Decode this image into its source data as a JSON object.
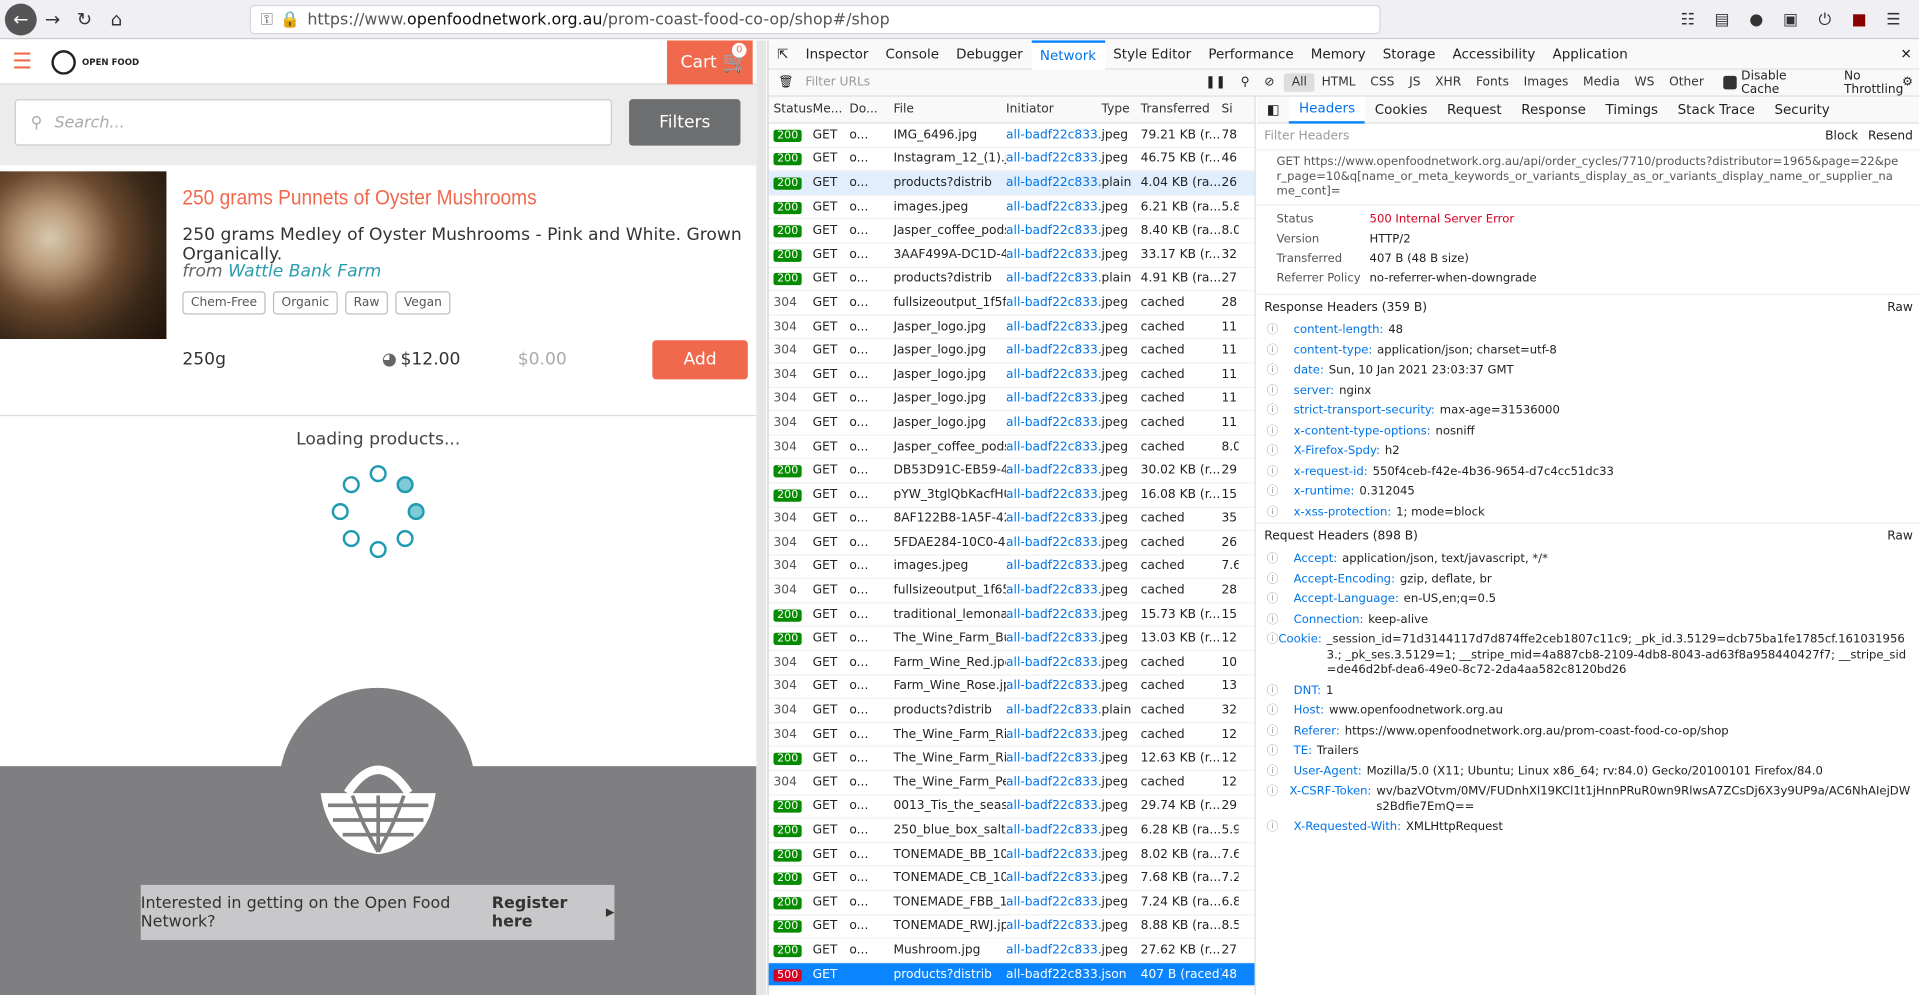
{
  "browser": {
    "url_prefix": "https://www.",
    "url_domain": "openfoodnetwork.org.au",
    "url_path": "/prom-coast-food-co-op/shop#/shop"
  },
  "shop": {
    "logo_text": "OPEN FOOD",
    "cart_label": "Cart",
    "cart_count": "0",
    "search_placeholder": "Search...",
    "filters_label": "Filters",
    "product": {
      "title": "250 grams Punnets of Oyster Mushrooms",
      "description": "250 grams Medley of Oyster Mushrooms - Pink and White. Grown Organically.",
      "from_prefix": "from",
      "producer": "Wattle Bank Farm",
      "tags": [
        "Chem-Free",
        "Organic",
        "Raw",
        "Vegan"
      ],
      "unit": "250g",
      "price": "$12.00",
      "price_zero": "$0.00",
      "add_label": "Add"
    },
    "loading": "Loading products...",
    "register_text": "Interested in getting on the Open Food Network?",
    "register_link": "Register here"
  },
  "devtools": {
    "tabs": [
      "Inspector",
      "Console",
      "Debugger",
      "Network",
      "Style Editor",
      "Performance",
      "Memory",
      "Storage",
      "Accessibility",
      "Application"
    ],
    "filter_placeholder": "Filter URLs",
    "filter_types": [
      "All",
      "HTML",
      "CSS",
      "JS",
      "XHR",
      "Fonts",
      "Images",
      "Media",
      "WS",
      "Other"
    ],
    "disable_cache": "Disable Cache",
    "throttling": "No Throttling",
    "columns": [
      "Status",
      "Me...",
      "Do...",
      "File",
      "Initiator",
      "Type",
      "Transferred",
      "Si"
    ],
    "rows": [
      [
        "200",
        "GET",
        "o...",
        "IMG_6496.jpg",
        "all-badf22c833...",
        "jpeg",
        "79.21 KB (r...",
        "78"
      ],
      [
        "200",
        "GET",
        "o...",
        "Instagram_12_(1).jpg",
        "all-badf22c833...",
        "jpeg",
        "46.75 KB (r...",
        "46"
      ],
      [
        "200",
        "GET",
        "o...",
        "products?distrib",
        "all-badf22c833...",
        "plain",
        "4.04 KB (ra...",
        "26"
      ],
      [
        "200",
        "GET",
        "o...",
        "images.jpeg",
        "all-badf22c833...",
        "jpeg",
        "6.21 KB (ra...",
        "5.8"
      ],
      [
        "200",
        "GET",
        "o...",
        "Jasper_coffee_pods.j",
        "all-badf22c833...",
        "jpeg",
        "8.40 KB (ra...",
        "8.0"
      ],
      [
        "200",
        "GET",
        "o...",
        "3AAF499A-DC1D-45A",
        "all-badf22c833...",
        "jpeg",
        "33.17 KB (r...",
        "32"
      ],
      [
        "200",
        "GET",
        "o...",
        "products?distrib",
        "all-badf22c833...",
        "plain",
        "4.91 KB (ra...",
        "27"
      ],
      [
        "304",
        "GET",
        "o...",
        "fullsizeoutput_1f5f.jp",
        "all-badf22c833...",
        "jpeg",
        "cached",
        "28"
      ],
      [
        "304",
        "GET",
        "o...",
        "Jasper_logo.jpg",
        "all-badf22c833...",
        "jpeg",
        "cached",
        "11"
      ],
      [
        "304",
        "GET",
        "o...",
        "Jasper_logo.jpg",
        "all-badf22c833...",
        "jpeg",
        "cached",
        "11"
      ],
      [
        "304",
        "GET",
        "o...",
        "Jasper_logo.jpg",
        "all-badf22c833...",
        "jpeg",
        "cached",
        "11"
      ],
      [
        "304",
        "GET",
        "o...",
        "Jasper_logo.jpg",
        "all-badf22c833...",
        "jpeg",
        "cached",
        "11"
      ],
      [
        "304",
        "GET",
        "o...",
        "Jasper_logo.jpg",
        "all-badf22c833...",
        "jpeg",
        "cached",
        "11"
      ],
      [
        "304",
        "GET",
        "o...",
        "Jasper_coffee_pods.j",
        "all-badf22c833...",
        "jpeg",
        "cached",
        "8.0"
      ],
      [
        "200",
        "GET",
        "o...",
        "DB53D91C-EB59-4D5",
        "all-badf22c833...",
        "jpeg",
        "30.02 KB (r...",
        "29"
      ],
      [
        "200",
        "GET",
        "o...",
        "pYW_3tglQbKacfH0p",
        "all-badf22c833...",
        "jpeg",
        "16.08 KB (r...",
        "15"
      ],
      [
        "304",
        "GET",
        "o...",
        "8AF122B8-1A5F-42DI",
        "all-badf22c833...",
        "jpeg",
        "cached",
        "35"
      ],
      [
        "304",
        "GET",
        "o...",
        "5FDAE284-10C0-487f",
        "all-badf22c833...",
        "jpeg",
        "cached",
        "26"
      ],
      [
        "304",
        "GET",
        "o...",
        "images.jpeg",
        "all-badf22c833...",
        "jpeg",
        "cached",
        "7.6"
      ],
      [
        "304",
        "GET",
        "o...",
        "fullsizeoutput_1f65.jj",
        "all-badf22c833...",
        "jpeg",
        "cached",
        "28"
      ],
      [
        "200",
        "GET",
        "o...",
        "traditional_lemonade",
        "all-badf22c833...",
        "jpeg",
        "15.73 KB (r...",
        "15"
      ],
      [
        "200",
        "GET",
        "o...",
        "The_Wine_Farm_Burg",
        "all-badf22c833...",
        "jpeg",
        "13.03 KB (r...",
        "12"
      ],
      [
        "304",
        "GET",
        "o...",
        "Farm_Wine_Red.jpg",
        "all-badf22c833...",
        "jpeg",
        "cached",
        "10"
      ],
      [
        "304",
        "GET",
        "o...",
        "Farm_Wine_Rose.jpg",
        "all-badf22c833...",
        "jpeg",
        "cached",
        "13"
      ],
      [
        "304",
        "GET",
        "o...",
        "products?distrib",
        "all-badf22c833...",
        "plain",
        "cached",
        "32"
      ],
      [
        "304",
        "GET",
        "o...",
        "The_Wine_Farm_Ries",
        "all-badf22c833...",
        "jpeg",
        "cached",
        "12"
      ],
      [
        "200",
        "GET",
        "o...",
        "The_Wine_Farm_Ries",
        "all-badf22c833...",
        "jpeg",
        "12.63 KB (r...",
        "12"
      ],
      [
        "304",
        "GET",
        "o...",
        "The_Wine_Farm_Pet_",
        "all-badf22c833...",
        "jpeg",
        "cached",
        "12"
      ],
      [
        "200",
        "GET",
        "o...",
        "0013_Tis_the_season",
        "all-badf22c833...",
        "jpeg",
        "29.74 KB (r...",
        "29"
      ],
      [
        "200",
        "GET",
        "o...",
        "250_blue_box_salt.jp",
        "all-badf22c833...",
        "jpeg",
        "6.28 KB (ra...",
        "5.9"
      ],
      [
        "200",
        "GET",
        "o...",
        "TONEMADE_BB_100g",
        "all-badf22c833...",
        "jpeg",
        "8.02 KB (ra...",
        "7.6"
      ],
      [
        "200",
        "GET",
        "o...",
        "TONEMADE_CB_100g",
        "all-badf22c833...",
        "jpeg",
        "7.68 KB (ra...",
        "7.2"
      ],
      [
        "200",
        "GET",
        "o...",
        "TONEMADE_FBB_100",
        "all-badf22c833...",
        "jpeg",
        "7.24 KB (ra...",
        "6.8"
      ],
      [
        "200",
        "GET",
        "o...",
        "TONEMADE_RWJ.jpg",
        "all-badf22c833...",
        "jpeg",
        "8.88 KB (ra...",
        "8.5"
      ],
      [
        "200",
        "GET",
        "o...",
        "Mushroom.jpg",
        "all-badf22c833...",
        "jpeg",
        "27.62 KB (r...",
        "27"
      ],
      [
        "500",
        "GET",
        "",
        "products?distrib",
        "all-badf22c833...",
        "json",
        "407 B (raced)",
        "48"
      ]
    ],
    "detail_tabs": [
      "Headers",
      "Cookies",
      "Request",
      "Response",
      "Timings",
      "Stack Trace",
      "Security"
    ],
    "filter_headers": "Filter Headers",
    "block": "Block",
    "resend": "Resend",
    "request_url": "GET https://www.openfoodnetwork.org.au/api/order_cycles/7710/products?distributor=1965&page=22&per_page=10&q[name_or_meta_keywords_or_variants_display_as_or_variants_display_name_or_supplier_name_cont]=",
    "summary": [
      [
        "Status",
        "500 Internal Server Error"
      ],
      [
        "Version",
        "HTTP/2"
      ],
      [
        "Transferred",
        "407 B (48 B size)"
      ],
      [
        "Referrer Policy",
        "no-referrer-when-downgrade"
      ]
    ],
    "response_headers_title": "Response Headers (359 B)",
    "raw": "Raw",
    "response_headers": [
      [
        "content-length:",
        "48"
      ],
      [
        "content-type:",
        "application/json; charset=utf-8"
      ],
      [
        "date:",
        "Sun, 10 Jan 2021 23:03:37 GMT"
      ],
      [
        "server:",
        "nginx"
      ],
      [
        "strict-transport-security:",
        "max-age=31536000"
      ],
      [
        "x-content-type-options:",
        "nosniff"
      ],
      [
        "X-Firefox-Spdy:",
        "h2"
      ],
      [
        "x-request-id:",
        "550f4ceb-f42e-4b36-9654-d7c4cc51dc33"
      ],
      [
        "x-runtime:",
        "0.312045"
      ],
      [
        "x-xss-protection:",
        "1; mode=block"
      ]
    ],
    "request_headers_title": "Request Headers (898 B)",
    "request_headers": [
      [
        "Accept:",
        "application/json, text/javascript, */*"
      ],
      [
        "Accept-Encoding:",
        "gzip, deflate, br"
      ],
      [
        "Accept-Language:",
        "en-US,en;q=0.5"
      ],
      [
        "Connection:",
        "keep-alive"
      ],
      [
        "Cookie:",
        "_session_id=71d3144117d7d874ffe2ceb1807c11c9; _pk_id.3.5129=dcb75ba1fe1785cf.1610319563.; _pk_ses.3.5129=1; __stripe_mid=4a887cb8-2109-4db8-8043-ad63f8a958440427f7; __stripe_sid=de46d2bf-dea6-49e0-8c72-2da4aa582c8120bd26"
      ],
      [
        "DNT:",
        "1"
      ],
      [
        "Host:",
        "www.openfoodnetwork.org.au"
      ],
      [
        "Referer:",
        "https://www.openfoodnetwork.org.au/prom-coast-food-co-op/shop"
      ],
      [
        "TE:",
        "Trailers"
      ],
      [
        "User-Agent:",
        "Mozilla/5.0 (X11; Ubuntu; Linux x86_64; rv:84.0) Gecko/20100101 Firefox/84.0"
      ],
      [
        "X-CSRF-Token:",
        "wv/bazVOtvm/0MV/FUDnhXl19KCl1t1jHnnPRuR0wn9RlwsA7ZCsDj6X3y9UP9a/AC6NhAIejDWs2Bdfie7EmQ=="
      ],
      [
        "X-Requested-With:",
        "XMLHttpRequest"
      ]
    ]
  }
}
